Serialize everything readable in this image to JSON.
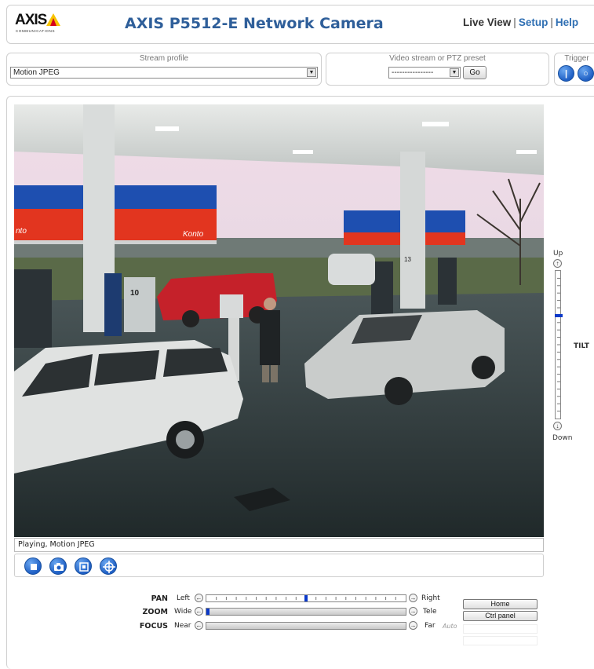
{
  "header": {
    "logo_text": "AXIS",
    "logo_sub": "COMMUNICATIONS",
    "title": "AXIS P5512-E Network Camera",
    "nav": {
      "live_view": "Live View",
      "setup": "Setup",
      "help": "Help"
    }
  },
  "stream_profile": {
    "label": "Stream profile",
    "selected": "Motion JPEG"
  },
  "ptz_preset": {
    "label": "Video stream or PTZ preset",
    "selected": "----------------",
    "go": "Go"
  },
  "trigger": {
    "label": "Trigger"
  },
  "video": {
    "status": "Playing, Motion JPEG",
    "signs": {
      "konto_left": "Konto",
      "konto_mid": "Konto",
      "left_edge": "nto",
      "pump_number": "10",
      "pump_number_right": "13"
    }
  },
  "tilt": {
    "label": "TILT",
    "up": "Up",
    "down": "Down",
    "position": 0.3
  },
  "pan": {
    "label": "PAN",
    "min": "Left",
    "max": "Right",
    "position": 0.5
  },
  "zoom": {
    "label": "ZOOM",
    "min": "Wide",
    "max": "Tele",
    "position": 0.0
  },
  "focus": {
    "label": "FOCUS",
    "min": "Near",
    "max": "Far",
    "auto": "Auto"
  },
  "buttons": {
    "home": "Home",
    "ctrl_panel": "Ctrl panel"
  },
  "colors": {
    "title": "#2f5f9a",
    "link": "#2f6fb3",
    "handle": "#0b39c9",
    "icon": "#1f5fc4"
  },
  "icons": [
    "stop-icon",
    "snapshot-icon",
    "fullscreen-icon",
    "ptz-crosshair-icon"
  ]
}
